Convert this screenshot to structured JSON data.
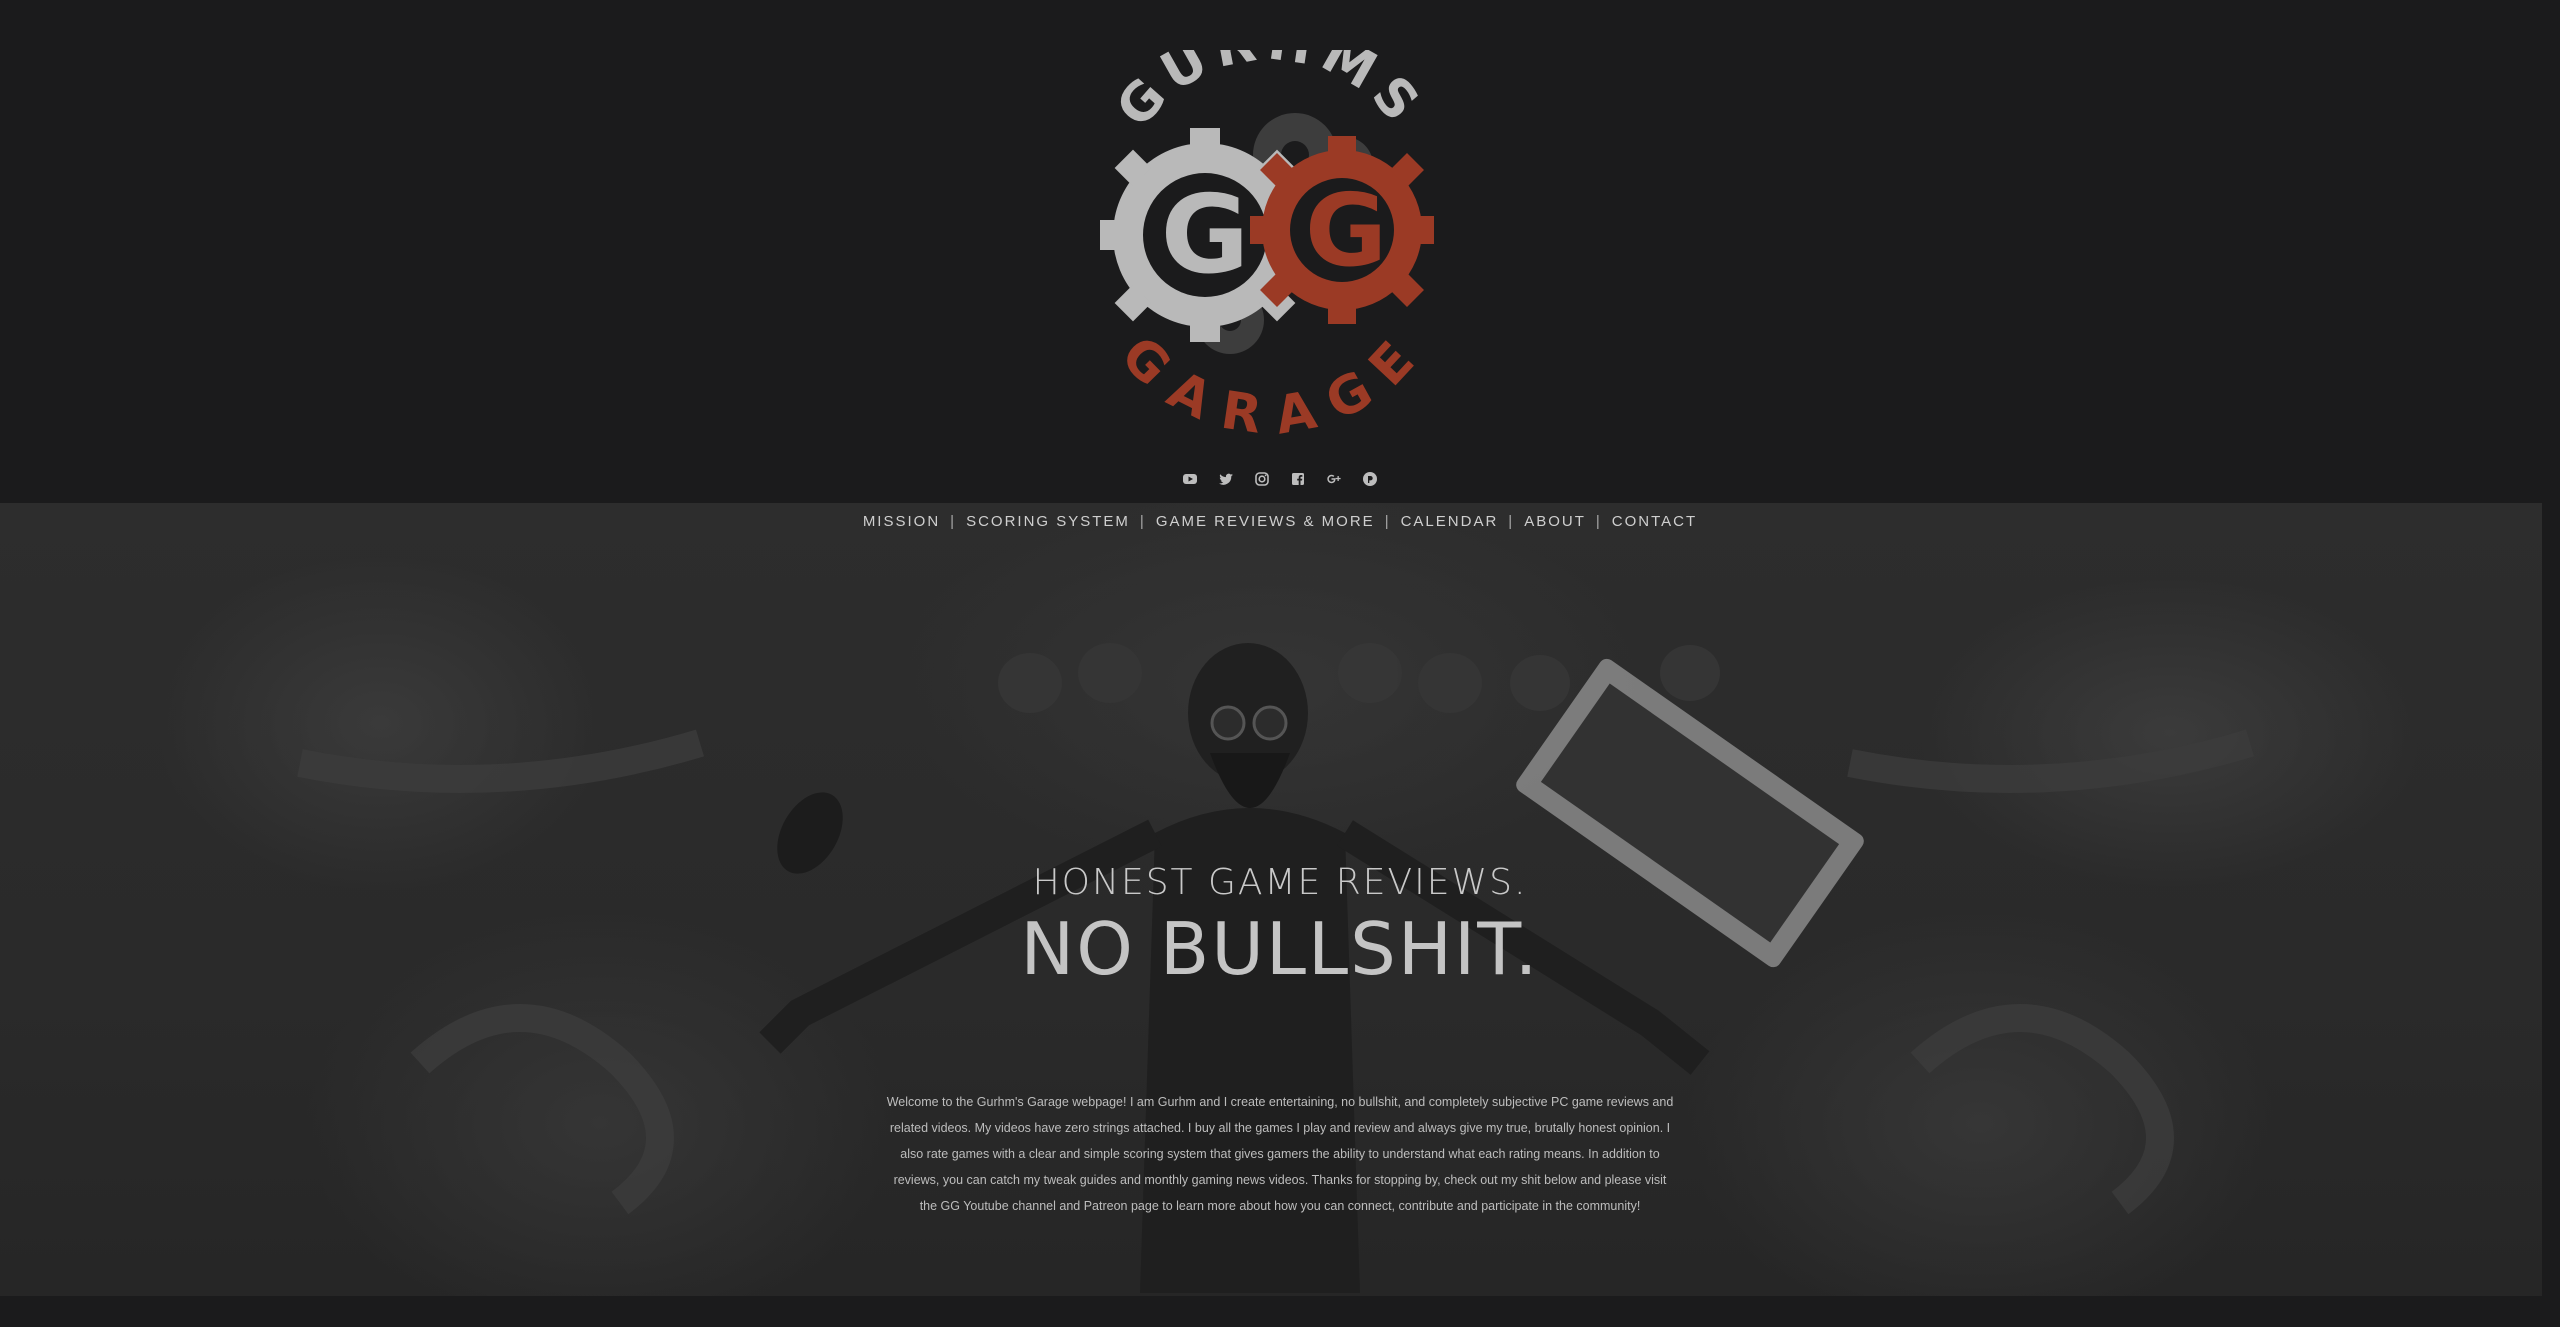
{
  "logo": {
    "top_text": "GURHMS",
    "bottom_text": "GARAGE",
    "monogram": "GG",
    "colors": {
      "gray": "#b9b9b9",
      "red": "#9b3a25",
      "dark_gear": "#3a3a3a"
    }
  },
  "social": [
    {
      "icon": "youtube-icon"
    },
    {
      "icon": "twitter-icon"
    },
    {
      "icon": "instagram-icon"
    },
    {
      "icon": "facebook-icon"
    },
    {
      "icon": "google-plus-icon"
    },
    {
      "icon": "patreon-icon"
    }
  ],
  "nav": {
    "items": [
      "MISSION",
      "SCORING SYSTEM",
      "GAME REVIEWS & MORE",
      "CALENDAR",
      "ABOUT",
      "CONTACT"
    ],
    "separator": "|"
  },
  "hero": {
    "tagline": "HONEST GAME REVIEWS.",
    "headline": "NO BULLSHIT.",
    "intro": "Welcome to the Gurhm's Garage webpage! I am Gurhm and I create entertaining, no bullshit, and completely subjective PC game reviews and related videos. My videos have zero strings attached. I buy all the games I play and review and always give my true, brutally honest opinion. I also rate games with a clear and simple scoring system that gives gamers the ability to understand what each rating means. In addition to reviews, you can catch my tweak guides and monthly gaming news videos. Thanks for stopping by, check out my shit below and please visit the GG Youtube channel and Patreon page to learn more about how you can connect, contribute and participate in the community!"
  },
  "colors": {
    "background": "#1b1b1c",
    "hero": "#2b2b2b",
    "text": "#bdbdbd"
  }
}
